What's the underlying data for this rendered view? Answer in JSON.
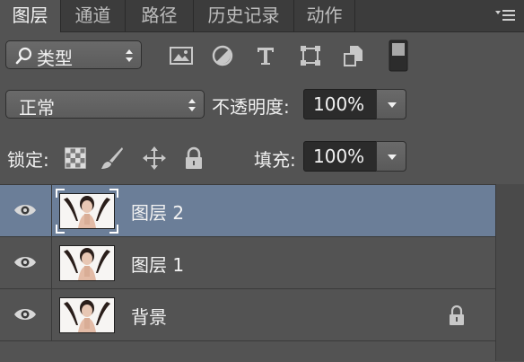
{
  "tabs": [
    {
      "label": "图层",
      "active": true
    },
    {
      "label": "通道",
      "active": false
    },
    {
      "label": "路径",
      "active": false
    },
    {
      "label": "历史记录",
      "active": false
    },
    {
      "label": "动作",
      "active": false
    }
  ],
  "filter": {
    "kind_label": "类型",
    "icons": [
      "image-filter-icon",
      "adjustment-filter-icon",
      "type-filter-icon",
      "shape-filter-icon",
      "smart-object-filter-icon",
      "filter-toggle-switch"
    ]
  },
  "blend": {
    "mode": "正常",
    "opacity_label": "不透明度:",
    "opacity_value": "100%"
  },
  "lock": {
    "label": "锁定:",
    "fill_label": "填充:",
    "fill_value": "100%"
  },
  "layers": [
    {
      "name": "图层 2",
      "selected": true,
      "visible": true,
      "locked": false
    },
    {
      "name": "图层 1",
      "selected": false,
      "visible": true,
      "locked": false
    },
    {
      "name": "背景",
      "selected": false,
      "visible": true,
      "locked": true
    }
  ],
  "colors": {
    "panel": "#535353",
    "tabbar": "#3c3c3c",
    "selected_row": "#6b7e98",
    "field": "#2b2b2b"
  }
}
